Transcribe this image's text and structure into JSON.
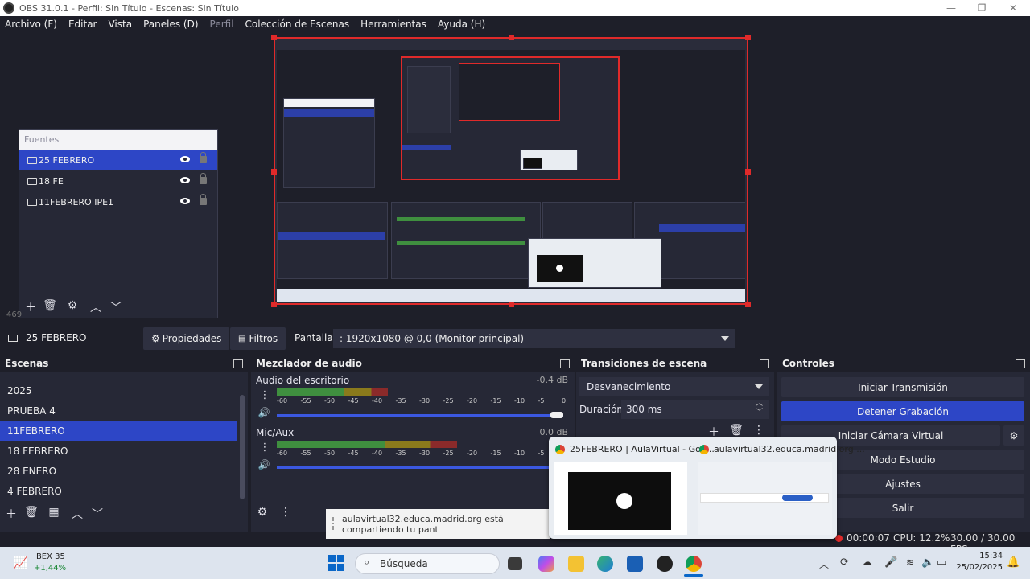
{
  "window": {
    "title": "OBS 31.0.1 - Perfil: Sin Título - Escenas: Sin Título",
    "minimize": "—",
    "maximize": "❐",
    "close": "✕"
  },
  "menu": [
    {
      "label": "Archivo (F)",
      "enabled": true
    },
    {
      "label": "Editar",
      "enabled": true
    },
    {
      "label": "Vista",
      "enabled": true
    },
    {
      "label": "Paneles (D)",
      "enabled": true
    },
    {
      "label": "Perfil",
      "enabled": false
    },
    {
      "label": "Colección de Escenas",
      "enabled": true
    },
    {
      "label": "Herramientas",
      "enabled": true
    },
    {
      "label": "Ayuda (H)",
      "enabled": true
    }
  ],
  "sources": {
    "title": "Fuentes",
    "items": [
      {
        "label": "25 FEBRERO",
        "selected": true
      },
      {
        "label": "18 FE",
        "selected": false
      },
      {
        "label": "11FEBRERO IPE1",
        "selected": false
      }
    ]
  },
  "source_toolbar": {
    "selected_source": "25 FEBRERO",
    "properties": "Propiedades",
    "filters": "Filtros",
    "display_label": "Pantalla",
    "display_value": ": 1920x1080 @ 0,0 (Monitor principal)"
  },
  "scenes": {
    "title": "Escenas",
    "items": [
      {
        "label": "2025",
        "selected": false
      },
      {
        "label": "PRUEBA 4",
        "selected": false
      },
      {
        "label": "11FEBRERO",
        "selected": true
      },
      {
        "label": "18 FEBRERO",
        "selected": false
      },
      {
        "label": "28 ENERO",
        "selected": false
      },
      {
        "label": "4 FEBRERO",
        "selected": false
      }
    ]
  },
  "mixer": {
    "title": "Mezclador de audio",
    "channels": [
      {
        "name": "Audio del escritorio",
        "db": "-0.4 dB",
        "level": 0.38,
        "volume": 1.0
      },
      {
        "name": "Mic/Aux",
        "db": "0.0 dB",
        "level": 0.62,
        "volume": 1.0
      }
    ],
    "scale": [
      "-60",
      "-55",
      "-50",
      "-45",
      "-40",
      "-35",
      "-30",
      "-25",
      "-20",
      "-15",
      "-10",
      "-5",
      "0"
    ]
  },
  "transitions": {
    "title": "Transiciones de escena",
    "selected": "Desvanecimiento",
    "duration_label": "Duración",
    "duration_value": "300 ms"
  },
  "controls": {
    "title": "Controles",
    "buttons": [
      {
        "label": "Iniciar Transmisión",
        "active": false
      },
      {
        "label": "Detener Grabación",
        "active": true
      },
      {
        "label": "Iniciar Cámara Virtual",
        "active": false
      },
      {
        "label": "Modo Estudio",
        "active": false
      },
      {
        "label": "Ajustes",
        "active": false
      },
      {
        "label": "Salir",
        "active": false
      }
    ]
  },
  "status": {
    "rec_time": "00:00:07",
    "cpu": "CPU: 12.2%",
    "fps": "30.00 / 30.00 FPS",
    "hidden_prefix": "469"
  },
  "popup": {
    "tab1": "25FEBRERO | AulaVirtual - Goo...",
    "tab2": "aulavirtual32.educa.madrid.org ..."
  },
  "share_bar": {
    "text": "aulavirtual32.educa.madrid.org está compartiendo tu pant"
  },
  "taskbar": {
    "widget_name": "IBEX 35",
    "widget_value": "+1,44%",
    "search_placeholder": "Búsqueda",
    "time": "15:34",
    "date": "25/02/2025"
  },
  "colors": {
    "accent": "#2d46c6",
    "record_red": "#e02a2a",
    "meter_green": "#4caf50",
    "meter_yellow": "#c9a227",
    "meter_red": "#b33"
  }
}
